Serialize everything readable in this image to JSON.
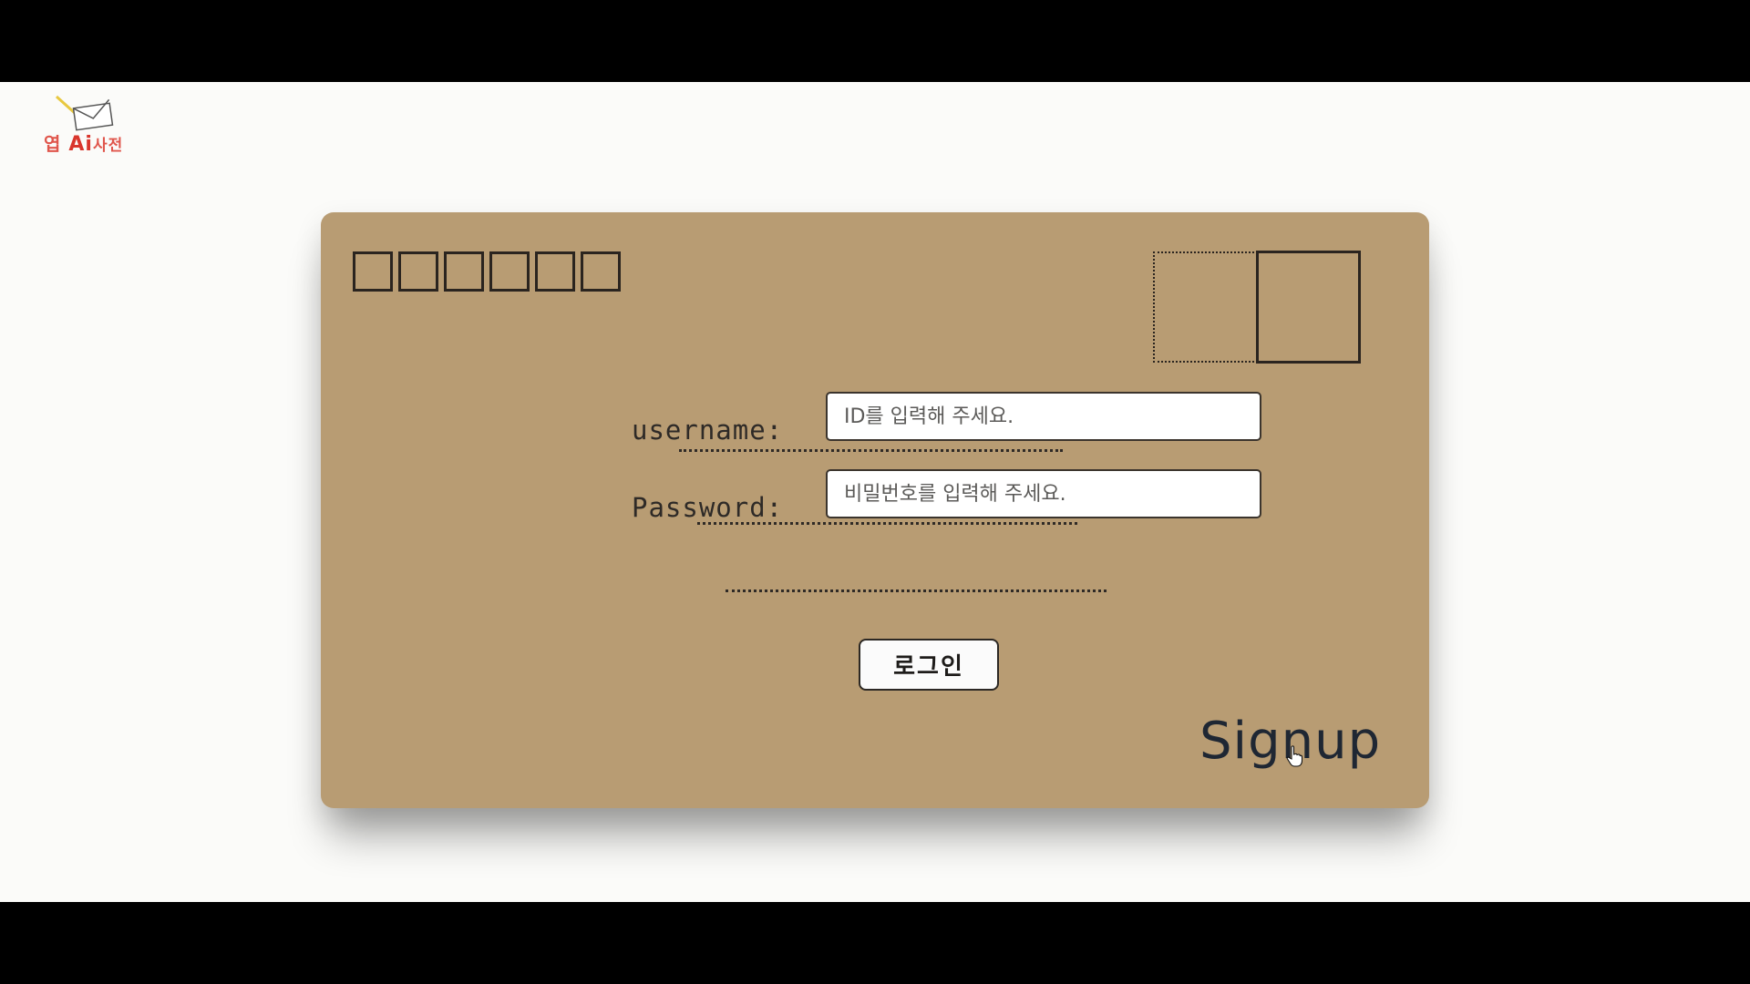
{
  "logo": {
    "text_left": "엽",
    "text_ai": "Ai",
    "text_right": "사전",
    "icon": "envelope-pencil-icon"
  },
  "envelope": {
    "zip_box_count": 6,
    "username_label": "username:",
    "username_placeholder": "ID를 입력해 주세요.",
    "password_label": "Password:",
    "password_placeholder": "비밀번호를 입력해 주세요.",
    "login_label": "로그인",
    "signup_label": "Signup"
  },
  "colors": {
    "envelope": "#b89c73",
    "background": "#fbfbf9",
    "logo_red": "#e0564c",
    "ink": "#2a241f"
  }
}
